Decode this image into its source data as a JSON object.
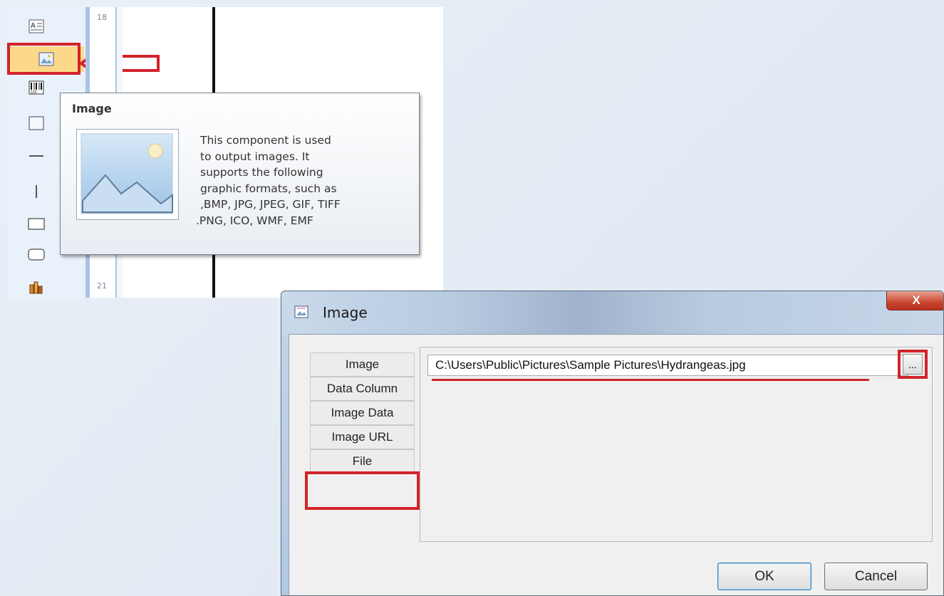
{
  "toolbox": {
    "tools": [
      {
        "name": "label-tool",
        "icon": "text-label-icon"
      },
      {
        "name": "image-tool",
        "icon": "picture-icon",
        "selected": true
      },
      {
        "name": "barcode-tool",
        "icon": "barcode-icon"
      },
      {
        "name": "panel-tool",
        "icon": "panel-icon"
      },
      {
        "name": "hline-tool",
        "icon": "horizontal-line-icon"
      },
      {
        "name": "vline-tool",
        "icon": "vertical-line-icon"
      },
      {
        "name": "rectangle-tool",
        "icon": "rectangle-icon"
      },
      {
        "name": "rounded-rectangle-tool",
        "icon": "rounded-rectangle-icon"
      },
      {
        "name": "chart-tool",
        "icon": "chart-icon"
      }
    ]
  },
  "ruler": {
    "top_number": "18",
    "bottom_number": "21"
  },
  "tooltip": {
    "title": "Image",
    "lines": [
      "This component is used",
      "to output images. It",
      "supports the following",
      "graphic formats, such as",
      ",BMP, JPG, JPEG, GIF, TIFF",
      ".PNG, ICO, WMF, EMF"
    ]
  },
  "dialog": {
    "title": "Image",
    "close_label": "X",
    "tabs": [
      "Image",
      "Data Column",
      "Image Data",
      "Image URL",
      "File"
    ],
    "active_tab": "File",
    "file_path": "C:\\Users\\Public\\Pictures\\Sample Pictures\\Hydrangeas.jpg",
    "browse_label": "...",
    "ok_label": "OK",
    "cancel_label": "Cancel"
  },
  "colors": {
    "highlight_red": "#d2232a",
    "selected_tool_bg": "#fbd88a",
    "close_button": "#c9452f"
  }
}
